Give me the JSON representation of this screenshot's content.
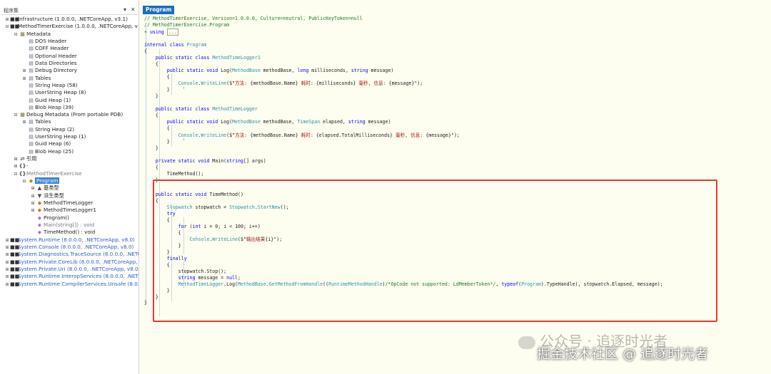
{
  "tree": {
    "title": "程序集",
    "pin_icon": "pin-icon",
    "close_icon": "close-icon",
    "nodes": [
      {
        "label": "Infrastructure (1.0.0.0, .NETCoreApp, v3.1)",
        "icon": "assembly-icon",
        "expander": "+",
        "style": "normal"
      },
      {
        "label": "MethodTimerExercise (1.0.0.0, .NETCoreApp, v",
        "icon": "assembly-icon",
        "expander": "-",
        "style": "normal"
      },
      {
        "label": "Metadata",
        "icon": "folder-icon",
        "expander": "-",
        "style": "normal"
      },
      {
        "label": "DOS Header",
        "icon": "page-icon",
        "expander": "",
        "style": "normal"
      },
      {
        "label": "COFF Header",
        "icon": "page-icon",
        "expander": "",
        "style": "normal"
      },
      {
        "label": "Optional Header",
        "icon": "page-icon",
        "expander": "",
        "style": "normal"
      },
      {
        "label": "Data Directories",
        "icon": "page-icon",
        "expander": "",
        "style": "normal"
      },
      {
        "label": "Debug Directory",
        "icon": "page-icon",
        "expander": "+",
        "style": "normal"
      },
      {
        "label": "Tables",
        "icon": "page-icon",
        "expander": "+",
        "style": "normal"
      },
      {
        "label": "String Heap (58)",
        "icon": "page-icon",
        "expander": "",
        "style": "normal"
      },
      {
        "label": "UserString Heap (8)",
        "icon": "page-icon",
        "expander": "",
        "style": "normal"
      },
      {
        "label": "Guid Heap (1)",
        "icon": "page-icon",
        "expander": "",
        "style": "normal"
      },
      {
        "label": "Blob Heap (39)",
        "icon": "page-icon",
        "expander": "",
        "style": "normal"
      },
      {
        "label": "Debug Metadata (From portable PDB)",
        "icon": "folder-icon",
        "expander": "-",
        "style": "normal"
      },
      {
        "label": "Tables",
        "icon": "page-icon",
        "expander": "+",
        "style": "normal"
      },
      {
        "label": "String Heap (2)",
        "icon": "page-icon",
        "expander": "",
        "style": "normal"
      },
      {
        "label": "UserString Heap (1)",
        "icon": "page-icon",
        "expander": "",
        "style": "normal"
      },
      {
        "label": "Guid Heap (6)",
        "icon": "page-icon",
        "expander": "",
        "style": "normal"
      },
      {
        "label": "Blob Heap (25)",
        "icon": "page-icon",
        "expander": "",
        "style": "normal"
      },
      {
        "label": "引用",
        "icon": "references-icon",
        "expander": "+",
        "style": "normal"
      },
      {
        "label": "-",
        "icon": "namespace-icon",
        "expander": "+",
        "style": "normal"
      },
      {
        "label": "MethodTimerExercise",
        "icon": "namespace-icon",
        "expander": "-",
        "style": "gray"
      },
      {
        "label": "Program",
        "icon": "class-icon",
        "expander": "-",
        "style": "selected"
      },
      {
        "label": "基类型",
        "icon": "base-types-icon",
        "expander": "+",
        "style": "normal"
      },
      {
        "label": "派生类型",
        "icon": "derived-types-icon",
        "expander": "+",
        "style": "normal"
      },
      {
        "label": "MethodTimeLogger",
        "icon": "class-icon",
        "expander": "+",
        "style": "normal"
      },
      {
        "label": "MethodTimeLogger1",
        "icon": "class-icon",
        "expander": "+",
        "style": "normal"
      },
      {
        "label": "Program()",
        "icon": "method-icon",
        "expander": "",
        "style": "normal"
      },
      {
        "label": "Main(string[]) : void",
        "icon": "method-icon",
        "expander": "",
        "style": "gray"
      },
      {
        "label": "TimeMethod() : void",
        "icon": "method-icon",
        "expander": "",
        "style": "normal"
      },
      {
        "label": "System.Runtime (8.0.0.0, .NETCoreApp, v8.0)",
        "icon": "assembly-icon",
        "expander": "+",
        "style": "blue"
      },
      {
        "label": "System.Console (8.0.0.0, .NETCoreApp, v8.0)",
        "icon": "assembly-icon",
        "expander": "+",
        "style": "blue"
      },
      {
        "label": "System.Diagnostics.TraceSource (8.0.0.0, .NETC",
        "icon": "assembly-icon",
        "expander": "+",
        "style": "blue"
      },
      {
        "label": "System.Private.CoreLib (8.0.0.0, .NETCoreApp, v",
        "icon": "assembly-icon",
        "expander": "+",
        "style": "blue"
      },
      {
        "label": "System.Private.Uri (8.0.0.0, .NETCoreApp, v8.0)",
        "icon": "assembly-icon",
        "expander": "+",
        "style": "blue"
      },
      {
        "label": "System.Runtime.InteropServices (8.0.0.0, .NETC",
        "icon": "assembly-icon",
        "expander": "+",
        "style": "blue"
      },
      {
        "label": "System.Runtime.CompilerServices.Unsafe (8.0.0.0",
        "icon": "assembly-icon",
        "expander": "+",
        "style": "blue"
      }
    ]
  },
  "editor": {
    "tab_label": "Program",
    "lines": [
      [
        [
          "c",
          "// MethodTimerExercise, Version=1.0.0.0, Culture=neutral, PublicKeyToken=null"
        ]
      ],
      [
        [
          "c",
          "// MethodTimerExercise.Program"
        ]
      ],
      [
        [
          "fold",
          "+ "
        ],
        [
          "k",
          "using"
        ],
        [
          "m",
          " "
        ],
        [
          "box",
          "..."
        ]
      ],
      [
        [
          "m",
          ""
        ]
      ],
      [
        [
          "k",
          "internal class"
        ],
        [
          "m",
          " "
        ],
        [
          "t",
          "Program"
        ]
      ],
      [
        [
          "m",
          "{"
        ]
      ],
      [
        [
          "m",
          "    "
        ],
        [
          "k",
          "public static class"
        ],
        [
          "m",
          " "
        ],
        [
          "t",
          "MethodTimeLogger1"
        ]
      ],
      [
        [
          "m",
          "    {"
        ]
      ],
      [
        [
          "m",
          "        "
        ],
        [
          "k",
          "public static void"
        ],
        [
          "m",
          " Log("
        ],
        [
          "t",
          "MethodBase"
        ],
        [
          "m",
          " methodBase, "
        ],
        [
          "k",
          "long"
        ],
        [
          "m",
          " milliseconds, "
        ],
        [
          "k",
          "string"
        ],
        [
          "m",
          " message)"
        ]
      ],
      [
        [
          "m",
          "        {"
        ]
      ],
      [
        [
          "m",
          "            "
        ],
        [
          "t",
          "Console"
        ],
        [
          "m",
          "."
        ],
        [
          "t",
          "WriteLine"
        ],
        [
          "m",
          "($\""
        ],
        [
          "s",
          "方法: "
        ],
        [
          "m",
          "{methodBase.Name}"
        ],
        [
          "s",
          " 耗时: "
        ],
        [
          "m",
          "{milliseconds}"
        ],
        [
          "s",
          " 毫秒, 信息: "
        ],
        [
          "m",
          "{message}\");"
        ]
      ],
      [
        [
          "m",
          "        }"
        ]
      ],
      [
        [
          "m",
          "    }"
        ]
      ],
      [
        [
          "m",
          ""
        ]
      ],
      [
        [
          "m",
          "    "
        ],
        [
          "k",
          "public static class"
        ],
        [
          "m",
          " "
        ],
        [
          "t",
          "MethodTimeLogger"
        ]
      ],
      [
        [
          "m",
          "    {"
        ]
      ],
      [
        [
          "m",
          "        "
        ],
        [
          "k",
          "public static void"
        ],
        [
          "m",
          " Log("
        ],
        [
          "t",
          "MethodBase"
        ],
        [
          "m",
          " methodBase, "
        ],
        [
          "t",
          "TimeSpan"
        ],
        [
          "m",
          " elapsed, "
        ],
        [
          "k",
          "string"
        ],
        [
          "m",
          " message)"
        ]
      ],
      [
        [
          "m",
          "        {"
        ]
      ],
      [
        [
          "m",
          "            "
        ],
        [
          "t",
          "Console"
        ],
        [
          "m",
          "."
        ],
        [
          "t",
          "WriteLine"
        ],
        [
          "m",
          "($\""
        ],
        [
          "s",
          "方法: "
        ],
        [
          "m",
          "{methodBase.Name}"
        ],
        [
          "s",
          " 耗时: "
        ],
        [
          "m",
          "{elapsed.TotalMilliseconds}"
        ],
        [
          "s",
          " 毫秒, 信息: "
        ],
        [
          "m",
          "{message}\");"
        ]
      ],
      [
        [
          "m",
          "        }"
        ]
      ],
      [
        [
          "m",
          "    }"
        ]
      ],
      [
        [
          "m",
          ""
        ]
      ],
      [
        [
          "m",
          "    "
        ],
        [
          "k",
          "private static void"
        ],
        [
          "m",
          " Main("
        ],
        [
          "k",
          "string"
        ],
        [
          "m",
          "[] args)"
        ]
      ],
      [
        [
          "m",
          "    {"
        ]
      ],
      [
        [
          "m",
          "        TimeMethod();"
        ]
      ],
      [
        [
          "m",
          "    }"
        ]
      ],
      [
        [
          "m",
          ""
        ]
      ],
      [
        [
          "m",
          "    "
        ],
        [
          "k",
          "public static void"
        ],
        [
          "m",
          " TimeMethod()"
        ]
      ],
      [
        [
          "m",
          "    {"
        ]
      ],
      [
        [
          "m",
          "        "
        ],
        [
          "t",
          "Stopwatch"
        ],
        [
          "m",
          " stopwatch = "
        ],
        [
          "t",
          "Stopwatch"
        ],
        [
          "m",
          "."
        ],
        [
          "t",
          "StartNew"
        ],
        [
          "m",
          "();"
        ]
      ],
      [
        [
          "m",
          "        "
        ],
        [
          "k",
          "try"
        ]
      ],
      [
        [
          "m",
          "        {"
        ]
      ],
      [
        [
          "m",
          "            "
        ],
        [
          "k",
          "for"
        ],
        [
          "m",
          " ("
        ],
        [
          "k",
          "int"
        ],
        [
          "m",
          " i = 0; i < 100; i++)"
        ]
      ],
      [
        [
          "m",
          "            {"
        ]
      ],
      [
        [
          "m",
          "                "
        ],
        [
          "t",
          "Console"
        ],
        [
          "m",
          "."
        ],
        [
          "t",
          "WriteLine"
        ],
        [
          "m",
          "($\""
        ],
        [
          "s",
          "输出结果"
        ],
        [
          "m",
          "{i}\");"
        ]
      ],
      [
        [
          "m",
          "            }"
        ]
      ],
      [
        [
          "m",
          "        }"
        ]
      ],
      [
        [
          "m",
          "        "
        ],
        [
          "k",
          "finally"
        ]
      ],
      [
        [
          "m",
          "        {"
        ]
      ],
      [
        [
          "m",
          "            stopwatch.Stop();"
        ]
      ],
      [
        [
          "m",
          "            "
        ],
        [
          "k",
          "string"
        ],
        [
          "m",
          " message = "
        ],
        [
          "k",
          "null"
        ],
        [
          "m",
          ";"
        ]
      ],
      [
        [
          "m",
          "            "
        ],
        [
          "t",
          "MethodTimeLogger"
        ],
        [
          "m",
          ".Log("
        ],
        [
          "t",
          "MethodBase"
        ],
        [
          "m",
          "."
        ],
        [
          "t",
          "GetMethodFromHandle"
        ],
        [
          "m",
          "(("
        ],
        [
          "t",
          "RuntimeMethodHandle"
        ],
        [
          "m",
          ")"
        ],
        [
          "c",
          "/*OpCode not supported: LdMemberToken*/"
        ],
        [
          "m",
          ", "
        ],
        [
          "k",
          "typeof"
        ],
        [
          "m",
          "("
        ],
        [
          "t",
          "Program"
        ],
        [
          "m",
          ").TypeHandle), stopwatch.Elapsed, message);"
        ]
      ],
      [
        [
          "m",
          "        }"
        ]
      ],
      [
        [
          "m",
          "    }"
        ]
      ],
      [
        [
          "m",
          "}"
        ]
      ]
    ]
  },
  "watermark": {
    "public_account": "公众号 · 追逐时光者",
    "juejin": "掘金技术社区 @ 追逐时光者"
  }
}
